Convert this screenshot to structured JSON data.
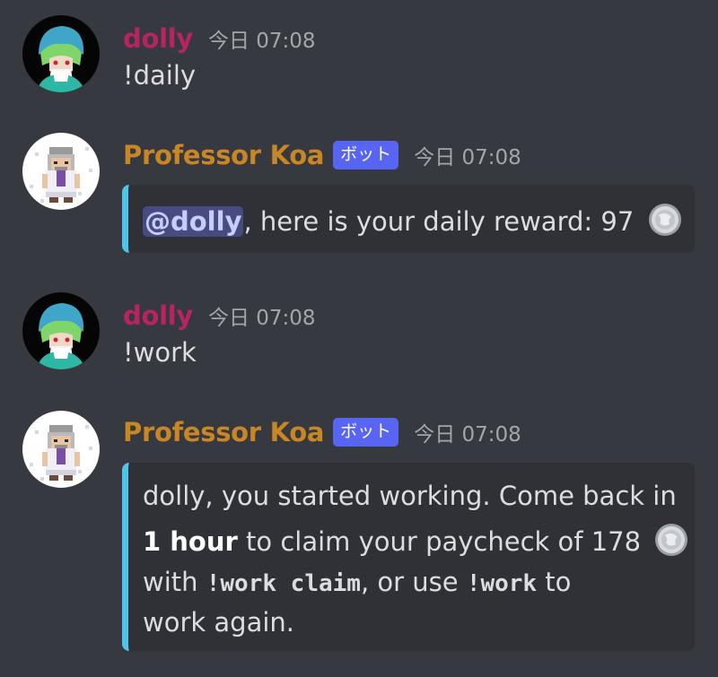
{
  "messages": [
    {
      "author": "dolly",
      "timestamp": "今日 07:08",
      "text": "!daily"
    },
    {
      "author": "Professor Koa",
      "bot_tag": "ボット",
      "timestamp": "今日 07:08",
      "embed": {
        "mention": "@dolly",
        "text": ", here is your daily reward: 97"
      }
    },
    {
      "author": "dolly",
      "timestamp": "今日 07:08",
      "text": "!work"
    },
    {
      "author": "Professor Koa",
      "bot_tag": "ボット",
      "timestamp": "今日 07:08",
      "embed": {
        "line1": "dolly, you started working. Come back in",
        "line2_bold": "1 hour",
        "line2_text": " to claim your paycheck of 178",
        "line3_pre": "with ",
        "line3_code1": "!work claim",
        "line3_mid": ", or use ",
        "line3_code2": "!work",
        "line3_post": " to",
        "line4": "work again."
      }
    }
  ],
  "colors": {
    "background": "#36393f",
    "user_name": "#b8245f",
    "bot_name": "#c98625",
    "bot_tag": "#5865f2",
    "embed_bar": "#4fc3e8",
    "embed_bg": "#2f3136"
  },
  "icons": {
    "user_avatar": "green-haired-character-avatar",
    "bot_avatar": "pixel-professor-avatar",
    "coin": "silver-coin-icon"
  }
}
